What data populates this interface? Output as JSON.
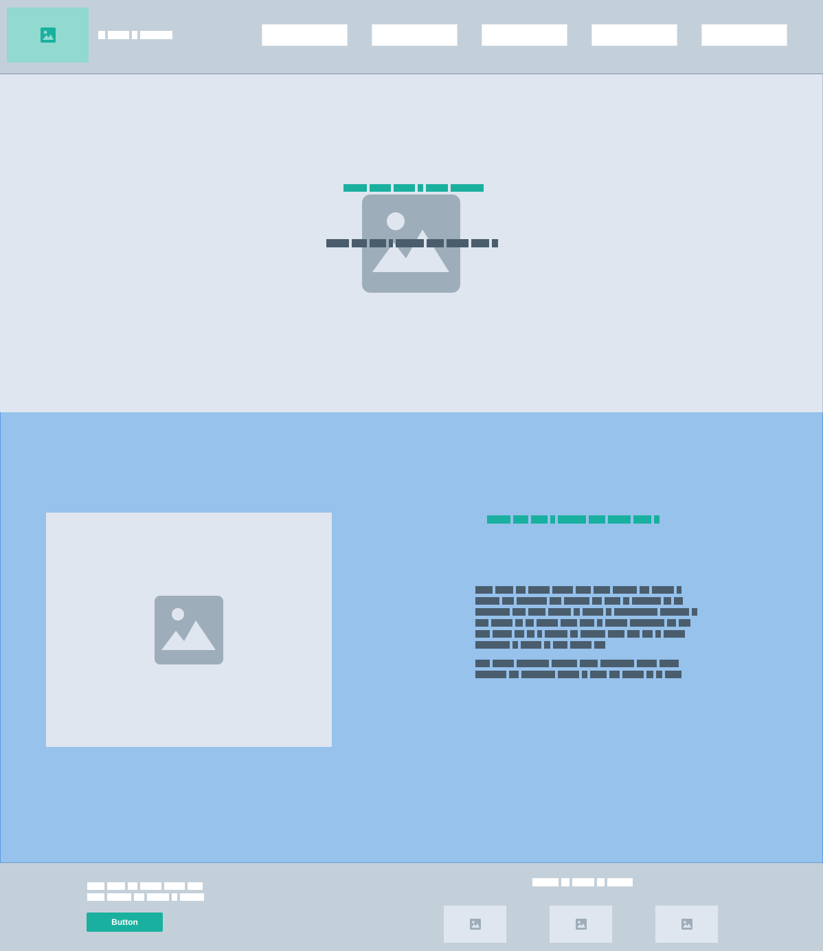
{
  "header": {
    "logo_icon": "image-icon",
    "nav_items": [
      "",
      "",
      "",
      "",
      ""
    ]
  },
  "hero": {
    "image_icon": "image-placeholder-icon"
  },
  "feature": {
    "image_icon": "image-placeholder-icon"
  },
  "footer": {
    "button_label": "Button",
    "thumbnail_icon": "image-icon"
  },
  "colors": {
    "accent": "#1ab09f",
    "header_bg": "#c4d0d9",
    "hero_bg": "#dfe6ef",
    "feature_bg": "#96c2ec",
    "text_dark": "#4a5d6d",
    "placeholder_icon": "#9eadba"
  }
}
